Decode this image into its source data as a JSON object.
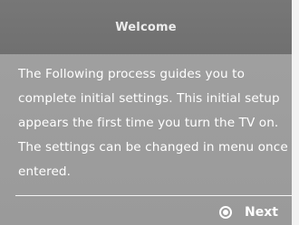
{
  "dialog": {
    "title": "Welcome",
    "body": "The Following process guides you to complete initial settings. This initial setup appears the first time you turn the TV on. The settings can be changed in menu once entered.",
    "next_label": "Next",
    "next_icon": "radio-icon"
  },
  "colors": {
    "title_bar": "#777777",
    "dialog_bg": "#9d9d9d",
    "text": "#ffffff"
  }
}
